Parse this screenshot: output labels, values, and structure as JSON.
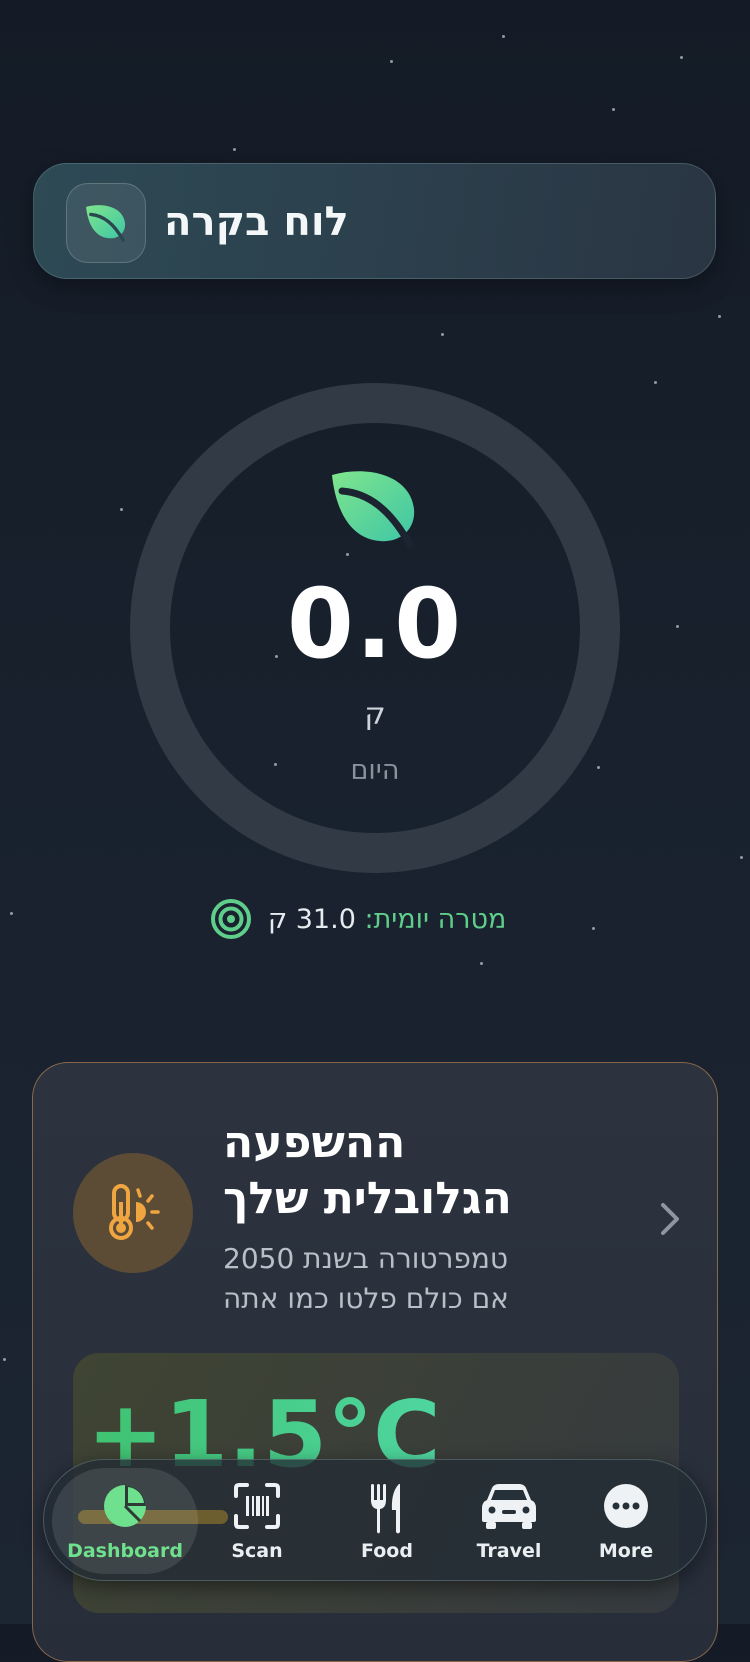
{
  "header": {
    "title": "לוח בקרה",
    "logo_icon": "leaf-icon"
  },
  "progress": {
    "value": "0.0",
    "unit": "ק",
    "period": "היום",
    "fraction": 0.0,
    "icon": "leaf-icon"
  },
  "goal": {
    "label": "מטרה יומית:",
    "value": "31.0 ק",
    "icon": "target-icon"
  },
  "impact_card": {
    "title_line1": "ההשפעה",
    "title_line2": "הגלובלית שלך",
    "desc_line1": "טמפרטורה בשנת 2050",
    "desc_line2": "אם כולם פלטו כמו אתה",
    "temperature": "+1.5°C",
    "icon": "thermometer-sun-icon",
    "chevron_icon": "chevron-right-icon"
  },
  "tabs": [
    {
      "label": "Dashboard",
      "icon": "pie-chart-icon",
      "active": true
    },
    {
      "label": "Scan",
      "icon": "barcode-scan-icon",
      "active": false
    },
    {
      "label": "Food",
      "icon": "fork-knife-icon",
      "active": false
    },
    {
      "label": "Travel",
      "icon": "car-icon",
      "active": false
    },
    {
      "label": "More",
      "icon": "more-icon",
      "active": false
    }
  ],
  "colors": {
    "accent": "#5fce8a",
    "warning": "#f0a640",
    "ring": "#313a45"
  }
}
